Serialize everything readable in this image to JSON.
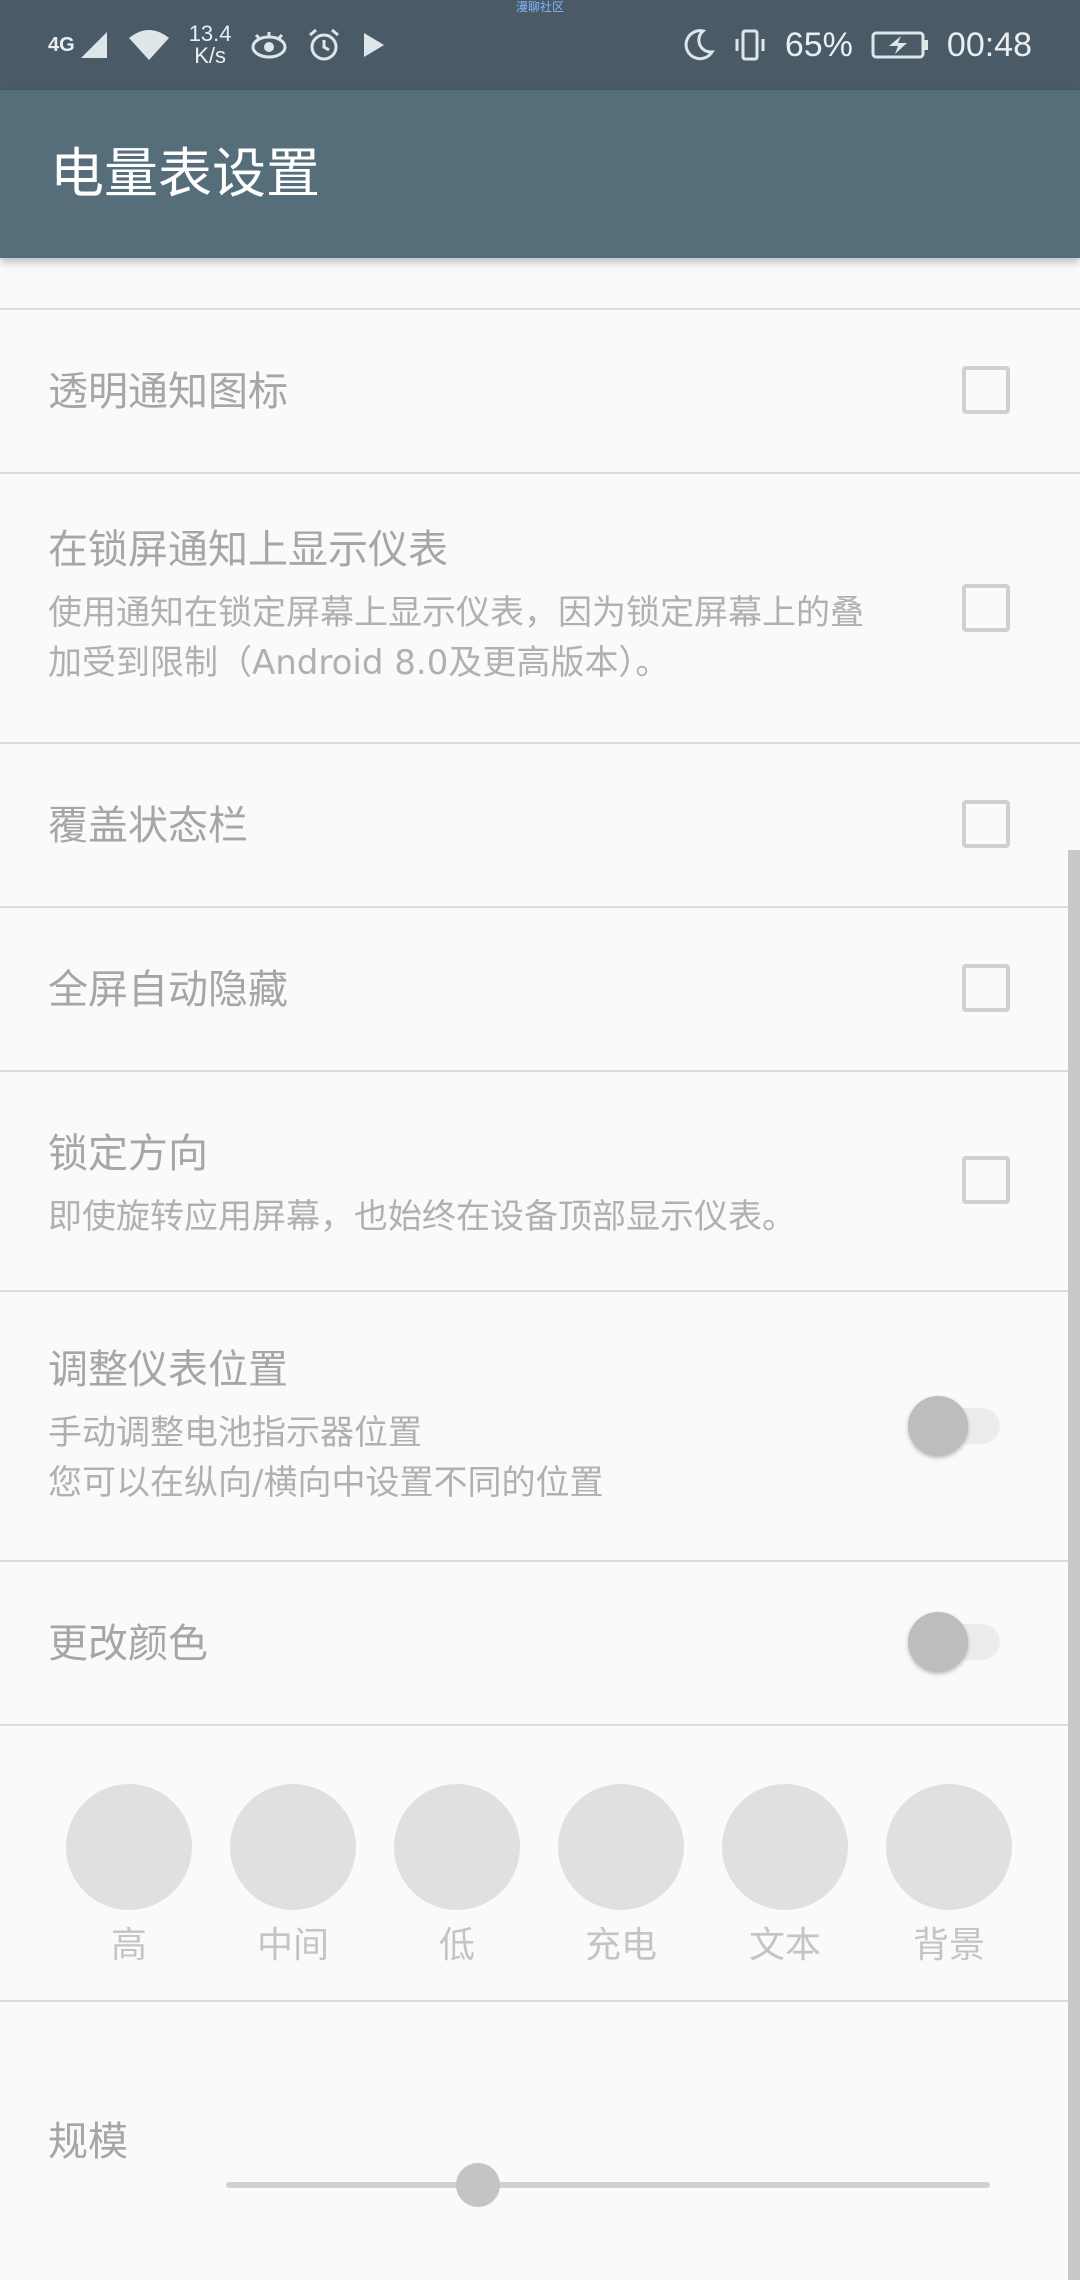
{
  "status_bar": {
    "top_label": "漫聊社区",
    "network": "4G",
    "speed_value": "13.4",
    "speed_unit": "K/s",
    "battery": "65%",
    "time": "00:48"
  },
  "app_bar": {
    "title": "电量表设置"
  },
  "settings": [
    {
      "title": "透明通知图标",
      "summary": "",
      "control": "checkbox"
    },
    {
      "title": "在锁屏通知上显示仪表",
      "summary": "使用通知在锁定屏幕上显示仪表，因为锁定屏幕上的叠加受到限制（Android 8.0及更高版本）。",
      "control": "checkbox"
    },
    {
      "title": "覆盖状态栏",
      "summary": "",
      "control": "checkbox"
    },
    {
      "title": "全屏自动隐藏",
      "summary": "",
      "control": "checkbox"
    },
    {
      "title": "锁定方向",
      "summary": "即使旋转应用屏幕，也始终在设备顶部显示仪表。",
      "control": "checkbox"
    },
    {
      "title": "调整仪表位置",
      "summary_line1": "手动调整电池指示器位置",
      "summary_line2": "您可以在纵向/横向中设置不同的位置",
      "control": "switch"
    },
    {
      "title": "更改颜色",
      "summary": "",
      "control": "switch"
    }
  ],
  "colors": [
    "高",
    "中间",
    "低",
    "充电",
    "文本",
    "背景"
  ],
  "scale": {
    "label": "规模",
    "value": 0.33
  }
}
